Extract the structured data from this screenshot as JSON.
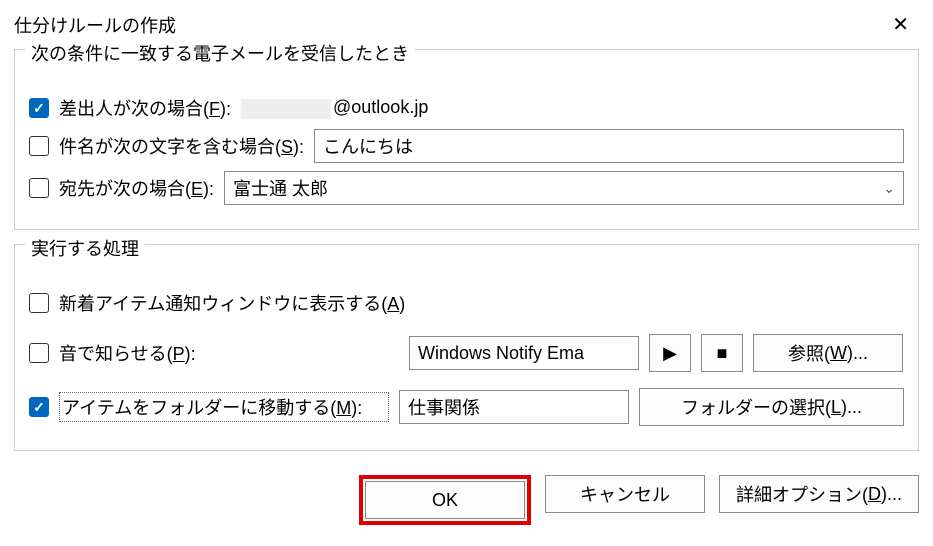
{
  "title": "仕分けルールの作成",
  "conditions": {
    "group_title": "次の条件に一致する電子メールを受信したとき",
    "from_label_prefix": "差出人が次の場合(",
    "from_label_key": "F",
    "from_label_suffix": "):",
    "from_value_suffix": "@outlook.jp",
    "subject_label_prefix": "件名が次の文字を含む場合(",
    "subject_label_key": "S",
    "subject_label_suffix": "):",
    "subject_value": "こんにちは",
    "to_label_prefix": "宛先が次の場合(",
    "to_label_key": "E",
    "to_label_suffix": "):",
    "to_value": "富士通 太郎"
  },
  "actions": {
    "group_title": "実行する処理",
    "alert_label_prefix": "新着アイテム通知ウィンドウに表示する(",
    "alert_label_key": "A",
    "alert_label_suffix": ")",
    "sound_label_prefix": "音で知らせる(",
    "sound_label_key": "P",
    "sound_label_suffix": "):",
    "sound_value": "Windows Notify Ema",
    "browse_prefix": "参照(",
    "browse_key": "W",
    "browse_suffix": ")...",
    "move_label_prefix": "アイテムをフォルダーに移動する(",
    "move_label_key": "M",
    "move_label_suffix": "):",
    "move_value": "仕事関係",
    "folder_select_prefix": "フォルダーの選択(",
    "folder_select_key": "L",
    "folder_select_suffix": ")..."
  },
  "buttons": {
    "ok": "OK",
    "cancel": "キャンセル",
    "advanced_prefix": "詳細オプション(",
    "advanced_key": "D",
    "advanced_suffix": ")..."
  },
  "icons": {
    "play": "▶",
    "stop": "■"
  }
}
